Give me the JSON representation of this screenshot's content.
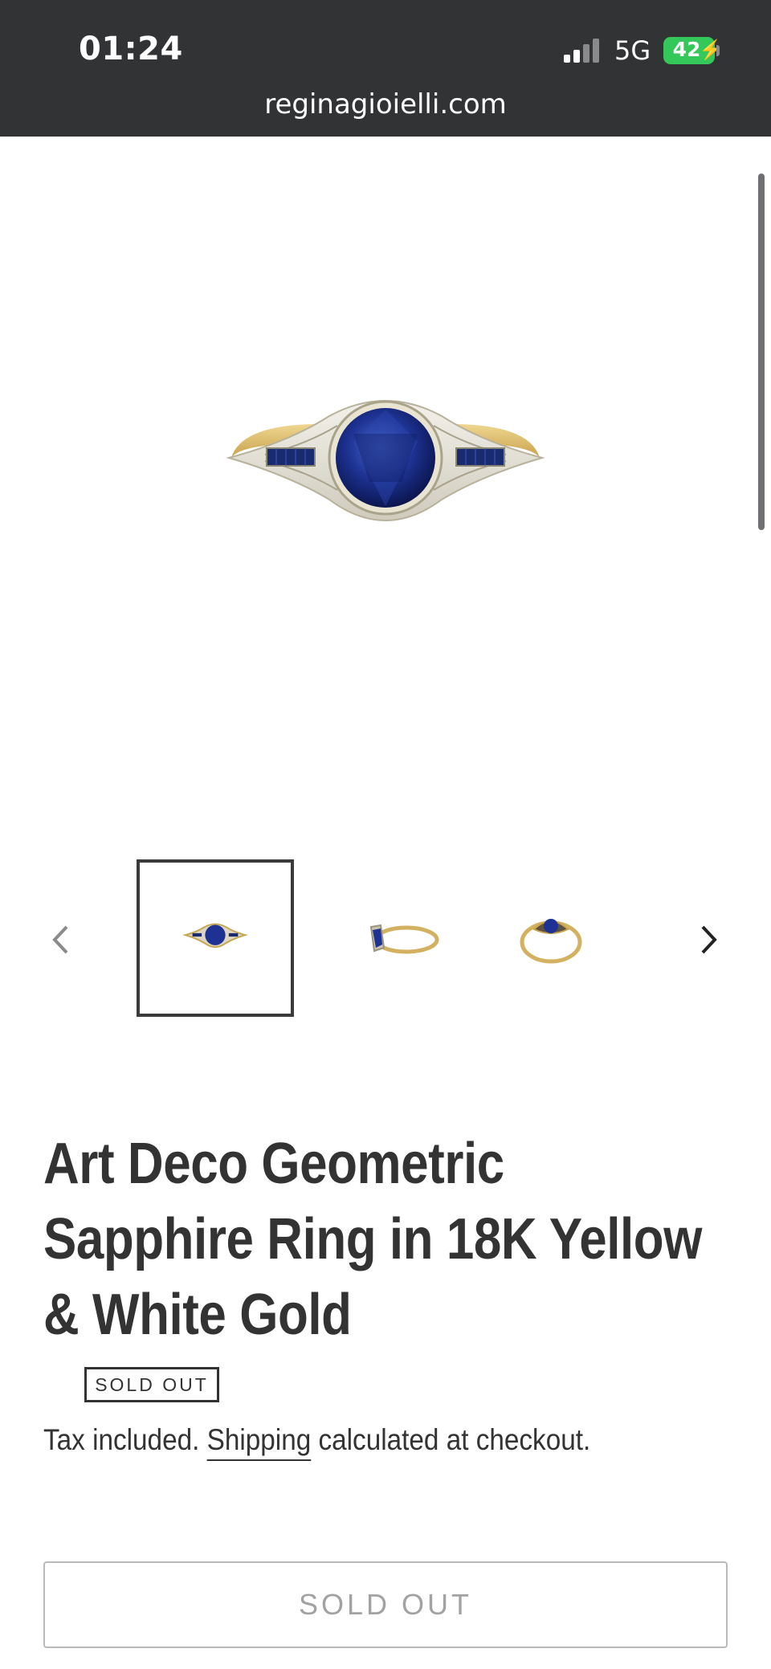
{
  "status_bar": {
    "time": "01:24",
    "network": "5G",
    "battery": "42",
    "battery_color": "#34c759",
    "signal_icon": "cellular-signal-icon",
    "battery_icon": "battery-charging-icon"
  },
  "browser": {
    "url": "reginagioielli.com"
  },
  "gallery": {
    "main_image": "sapphire-ring-front-image",
    "prev_icon": "chevron-left-icon",
    "next_icon": "chevron-right-icon",
    "thumbnails": [
      {
        "name": "thumbnail-front",
        "active": true
      },
      {
        "name": "thumbnail-side",
        "active": false
      },
      {
        "name": "thumbnail-top",
        "active": false
      }
    ]
  },
  "product": {
    "title_line1": "Art Deco Geometric",
    "title_line2": "Sapphire Ring in 18K Yellow",
    "title_line3": "& White Gold",
    "badge": "SOLD OUT",
    "tax_prefix": "Tax included.",
    "tax_link": "Shipping",
    "tax_suffix": "calculated at checkout.",
    "button_label": "SOLD OUT"
  },
  "colors": {
    "topbar": "#323335",
    "text": "#333333",
    "sapphire": "#1b2f86",
    "gold": "#d8b765"
  }
}
